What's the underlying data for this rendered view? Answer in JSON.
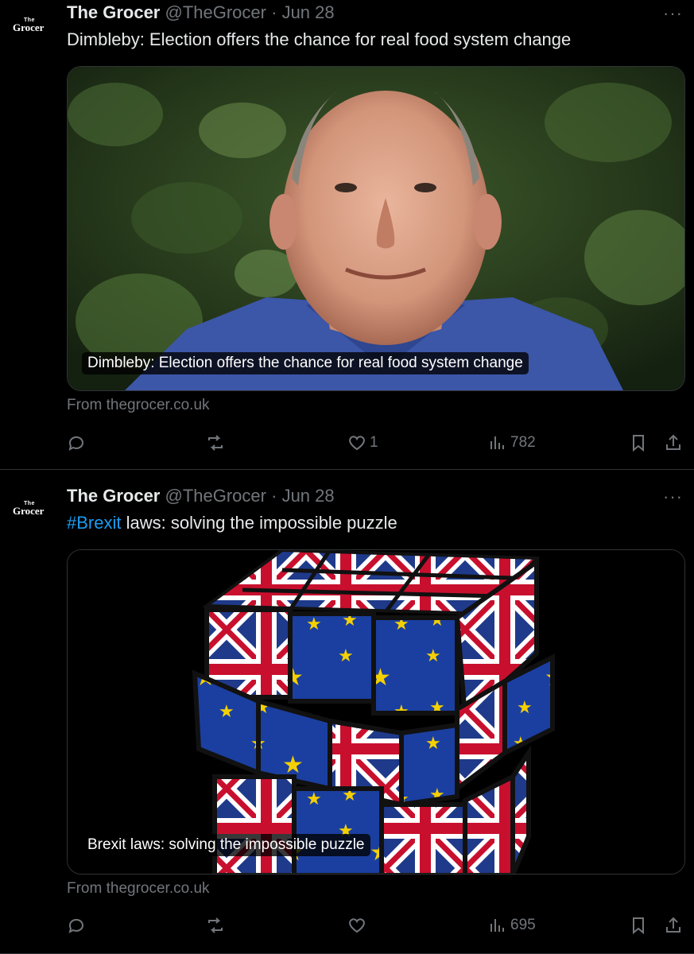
{
  "tweets": [
    {
      "avatar": {
        "small": "The",
        "main": "Grocer"
      },
      "name": "The Grocer",
      "handle": "@TheGrocer",
      "separator": "·",
      "date": "Jun 28",
      "more": "···",
      "text_plain": "Dimbleby: Election offers the chance for real food system change",
      "card": {
        "caption": "Dimbleby: Election offers the chance for real food system change",
        "source": "From thegrocer.co.uk"
      },
      "actions": {
        "reply_icon": "reply-icon",
        "retweet_icon": "retweet-icon",
        "like_icon": "heart-icon",
        "like_count": "1",
        "views_icon": "views-icon",
        "view_count": "782",
        "bookmark_icon": "bookmark-icon",
        "share_icon": "share-icon"
      }
    },
    {
      "avatar": {
        "small": "The",
        "main": "Grocer"
      },
      "name": "The Grocer",
      "handle": "@TheGrocer",
      "separator": "·",
      "date": "Jun 28",
      "more": "···",
      "text_hashtag": "#Brexit",
      "text_rest": " laws: solving the impossible puzzle",
      "card": {
        "caption": "Brexit laws: solving the impossible puzzle",
        "source": "From thegrocer.co.uk"
      },
      "actions": {
        "reply_icon": "reply-icon",
        "retweet_icon": "retweet-icon",
        "like_icon": "heart-icon",
        "views_icon": "views-icon",
        "view_count": "695",
        "bookmark_icon": "bookmark-icon",
        "share_icon": "share-icon"
      }
    }
  ],
  "colors": {
    "background": "#000000",
    "text": "#e7e9ea",
    "muted": "#71767b",
    "link": "#1d9bf0",
    "border": "#2f3336"
  }
}
